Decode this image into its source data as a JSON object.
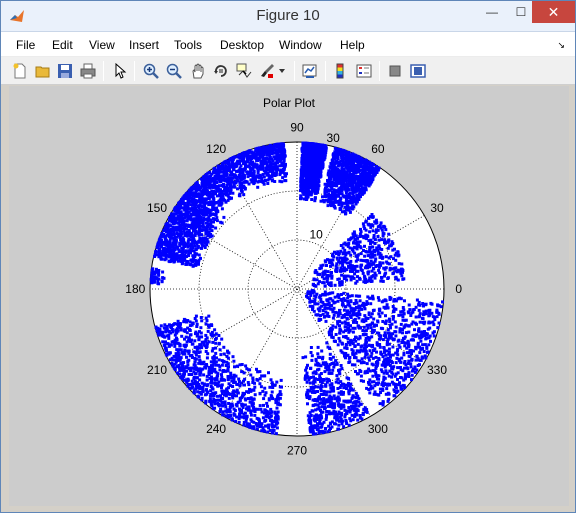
{
  "window": {
    "title": "Figure 10",
    "controls": {
      "minimize": "—",
      "maximize": "☐",
      "close": "✕"
    }
  },
  "menubar": {
    "items": [
      "File",
      "Edit",
      "View",
      "Insert",
      "Tools",
      "Desktop",
      "Window",
      "Help"
    ]
  },
  "toolbar": {
    "icons": [
      "new-figure-icon",
      "open-file-icon",
      "save-icon",
      "print-icon",
      "select-arrow-icon",
      "zoom-in-icon",
      "zoom-out-icon",
      "pan-hand-icon",
      "rotate-3d-icon",
      "data-cursor-icon",
      "brush-icon",
      "link-plot-icon",
      "colorbar-icon",
      "legend-icon",
      "hide-plot-tools-icon",
      "show-plot-tools-icon"
    ]
  },
  "chart_data": {
    "type": "scatter",
    "coordinate_system": "polar",
    "title": "Polar Plot",
    "angle_tick_labels": [
      "0",
      "30",
      "60",
      "90",
      "120",
      "150",
      "180",
      "210",
      "240",
      "270",
      "300",
      "330"
    ],
    "radial_tick_labels": [
      "10",
      "30"
    ],
    "radial_ticks": [
      10,
      20,
      30
    ],
    "rlim": [
      0,
      30
    ],
    "grid": "dotted",
    "marker_color": "#0000ff",
    "marker_style": "dot",
    "clusters": [
      {
        "theta_range": [
          55,
          75
        ],
        "r_range": [
          18,
          30
        ],
        "density": "high"
      },
      {
        "theta_range": [
          78,
          88
        ],
        "r_range": [
          18,
          30
        ],
        "density": "high"
      },
      {
        "theta_range": [
          95,
          135
        ],
        "r_range": [
          22,
          30
        ],
        "density": "high"
      },
      {
        "theta_range": [
          135,
          168
        ],
        "r_range": [
          20,
          30
        ],
        "density": "high"
      },
      {
        "theta_range": [
          172,
          178
        ],
        "r_range": [
          27,
          30
        ],
        "density": "low"
      },
      {
        "theta_range": [
          195,
          262
        ],
        "r_range": [
          18,
          30
        ],
        "density": "high"
      },
      {
        "theta_range": [
          275,
          300
        ],
        "r_range": [
          12,
          30
        ],
        "density": "medium"
      },
      {
        "theta_range": [
          305,
          355
        ],
        "r_range": [
          2,
          30
        ],
        "density": "high"
      },
      {
        "theta_range": [
          5,
          45
        ],
        "r_range": [
          3,
          22
        ],
        "density": "medium"
      }
    ],
    "colors": {
      "figure_background": "#cccccc",
      "axes_background": "#ffffff",
      "points": "#0000ff"
    }
  }
}
